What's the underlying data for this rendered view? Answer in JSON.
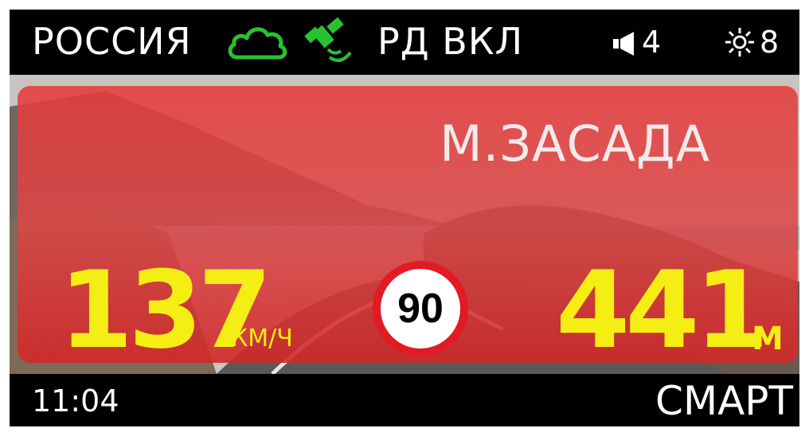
{
  "status_bar": {
    "region": "РОССИЯ",
    "cloud_icon": "cloud-icon",
    "satellite_icon": "satellite-icon",
    "rd_status": "РД ВКЛ",
    "volume_icon": "speaker-icon",
    "volume_level": "4",
    "brightness_icon": "sun-icon",
    "brightness_level": "8",
    "icon_color": "#29c22f"
  },
  "alert": {
    "type": "М.ЗАСАДА",
    "current_speed": "137",
    "speed_unit": "КМ/Ч",
    "speed_limit": "90",
    "distance": "441",
    "distance_unit": "М",
    "panel_color": "#e23c3c",
    "value_color": "#f5ee14"
  },
  "footer": {
    "time": "11:04",
    "mode": "СМАРТ"
  }
}
